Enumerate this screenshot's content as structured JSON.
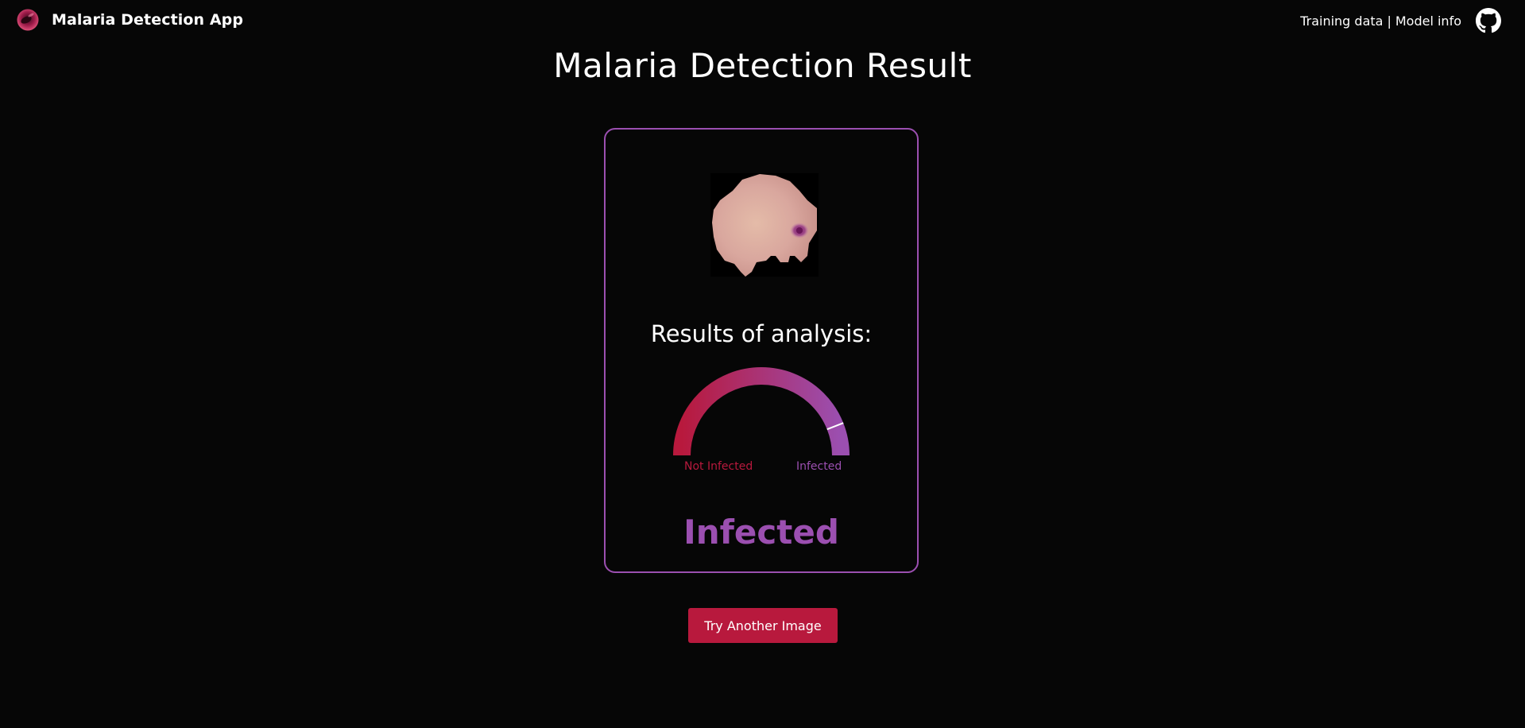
{
  "header": {
    "app_name": "Malaria Detection App",
    "logo_icon": "red-blood-cell-icon",
    "links": {
      "training_data": "Training data",
      "separator": "|",
      "model_info": "Model info"
    },
    "github_icon": "github-icon"
  },
  "page": {
    "title": "Malaria Detection Result"
  },
  "result": {
    "image_alt": "blood cell sample",
    "heading": "Results of analysis:",
    "gauge": {
      "left_label": "Not Infected",
      "right_label": "Infected",
      "value": 0.88
    },
    "verdict": "Infected"
  },
  "actions": {
    "try_another": "Try Another Image"
  },
  "colors": {
    "background": "#060606",
    "not_infected": "#b8193d",
    "infected": "#9b4fb0",
    "button": "#b8193d"
  }
}
